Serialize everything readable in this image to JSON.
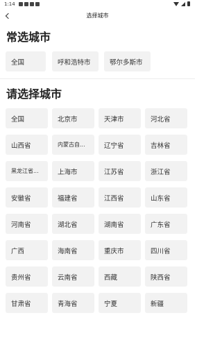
{
  "status_bar": {
    "time": "1:14"
  },
  "header": {
    "title": "选择城市"
  },
  "common": {
    "title": "常选城市",
    "items": [
      "全国",
      "呼和浩特市",
      "鄂尔多斯市"
    ]
  },
  "select": {
    "title": "请选择城市",
    "items": [
      "全国",
      "北京市",
      "天津市",
      "河北省",
      "山西省",
      "内蒙古自...",
      "辽宁省",
      "吉林省",
      "黑龙江省...",
      "上海市",
      "江苏省",
      "浙江省",
      "安徽省",
      "福建省",
      "江西省",
      "山东省",
      "河南省",
      "湖北省",
      "湖南省",
      "广东省",
      "广西",
      "海南省",
      "重庆市",
      "四川省",
      "贵州省",
      "云南省",
      "西藏",
      "陕西省",
      "甘肃省",
      "青海省",
      "宁夏",
      "新疆"
    ]
  }
}
